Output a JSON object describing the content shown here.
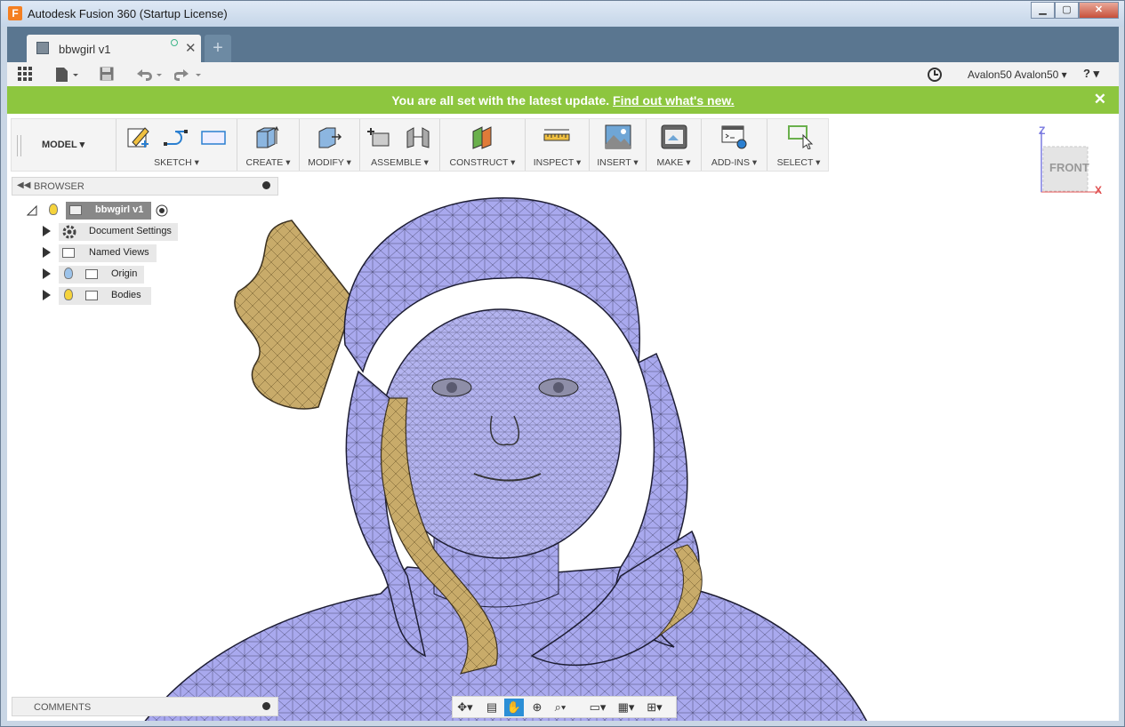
{
  "window": {
    "title": "Autodesk Fusion 360 (Startup License)",
    "app_icon_letter": "F"
  },
  "doc_tab": {
    "name": "bbwgirl v1",
    "close": "✕",
    "new": "+"
  },
  "qat": {
    "user": "Avalon50 Avalon50 ▾",
    "help": "? ▾"
  },
  "banner": {
    "message": "You are all set with the latest update.",
    "link": "Find out what's new.",
    "close": "✕"
  },
  "toolbar": {
    "workspace": "MODEL ▾",
    "groups": [
      {
        "label": "SKETCH ▾"
      },
      {
        "label": "CREATE ▾"
      },
      {
        "label": "MODIFY ▾"
      },
      {
        "label": "ASSEMBLE ▾"
      },
      {
        "label": "CONSTRUCT ▾"
      },
      {
        "label": "INSPECT ▾"
      },
      {
        "label": "INSERT ▾"
      },
      {
        "label": "MAKE ▾"
      },
      {
        "label": "ADD-INS ▾"
      },
      {
        "label": "SELECT ▾"
      }
    ]
  },
  "browser": {
    "title": "BROWSER",
    "root": "bbwgirl v1",
    "items": [
      {
        "label": "Document Settings"
      },
      {
        "label": "Named Views"
      },
      {
        "label": "Origin"
      },
      {
        "label": "Bodies"
      }
    ]
  },
  "viewcube": {
    "face": "FRONT",
    "z": "Z",
    "x": "X"
  },
  "comments": {
    "title": "COMMENTS"
  },
  "colors": {
    "accent": "#8dc63f",
    "tabstrip": "#5a7690",
    "active_tool": "#2c8fd6",
    "mesh": "#a8a8ee",
    "hair": "#c9ad6e"
  }
}
